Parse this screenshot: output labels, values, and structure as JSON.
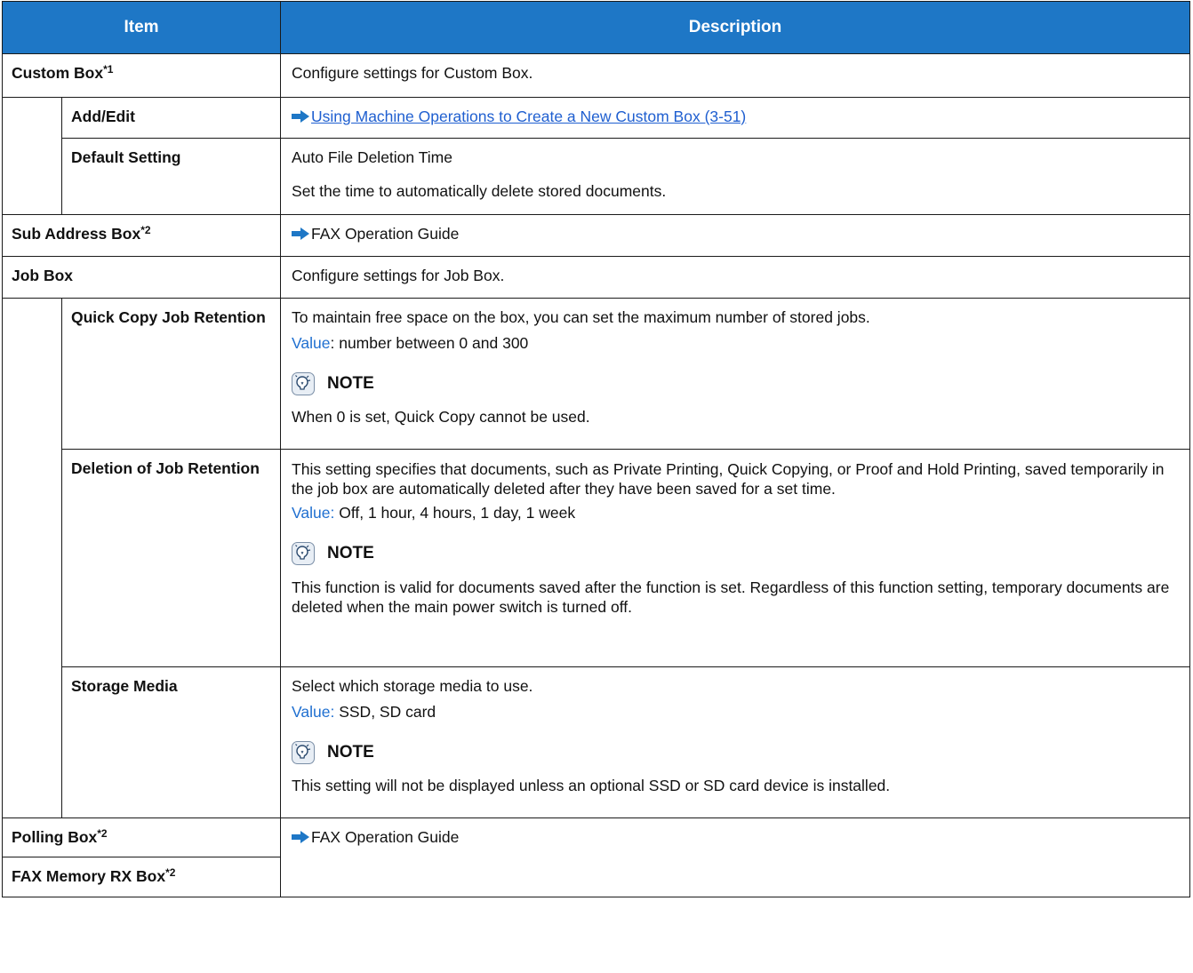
{
  "header": {
    "item": "Item",
    "description": "Description"
  },
  "rows": {
    "custom_box": {
      "label": "Custom Box",
      "sup": "*1",
      "desc": "Configure settings for Custom Box."
    },
    "add_edit": {
      "label": "Add/Edit",
      "link": "Using Machine Operations to Create a New Custom Box (3-51)"
    },
    "default_setting": {
      "label": "Default Setting",
      "line1": "Auto File Deletion Time",
      "line2": "Set the time to automatically delete stored documents."
    },
    "sub_address": {
      "label": "Sub Address Box",
      "sup": "*2",
      "ref": "FAX Operation Guide"
    },
    "job_box": {
      "label": "Job Box",
      "desc": "Configure settings for Job Box."
    },
    "quick_copy": {
      "label": "Quick Copy Job Retention",
      "desc": "To maintain free space on the box, you can set the maximum number of stored jobs.",
      "value_label": "Value",
      "value_text": ": number between 0 and 300",
      "note_title": "NOTE",
      "note_text": "When 0 is set, Quick Copy cannot be used."
    },
    "deletion": {
      "label": "Deletion of Job Retention",
      "desc": "This setting specifies that documents, such as Private Printing, Quick Copying, or Proof and Hold Printing, saved temporarily in the job box are automatically deleted after they have been saved for a set time.",
      "value_label": "Value:",
      "value_text": " Off, 1 hour, 4 hours, 1 day, 1 week",
      "note_title": "NOTE",
      "note_text": "This function is valid for documents saved after the function is set. Regardless of this function setting, temporary documents are deleted when the main power switch is turned off."
    },
    "storage_media": {
      "label": "Storage Media",
      "desc": "Select which storage media to use.",
      "value_label": "Value:",
      "value_text": " SSD, SD card",
      "note_title": "NOTE",
      "note_text": "This setting will not be displayed unless an optional SSD or SD card device is installed."
    },
    "polling_box": {
      "label": "Polling Box",
      "sup": "*2",
      "ref": "FAX Operation Guide"
    },
    "fax_memory": {
      "label": "FAX Memory RX Box",
      "sup": "*2"
    }
  },
  "colors": {
    "header_bg": "#1e77c6",
    "value_label": "#1f6fd0",
    "arrow": "#1e77c6"
  },
  "icons": {
    "arrow": "right-arrow-icon",
    "note": "note-bulb-icon"
  }
}
